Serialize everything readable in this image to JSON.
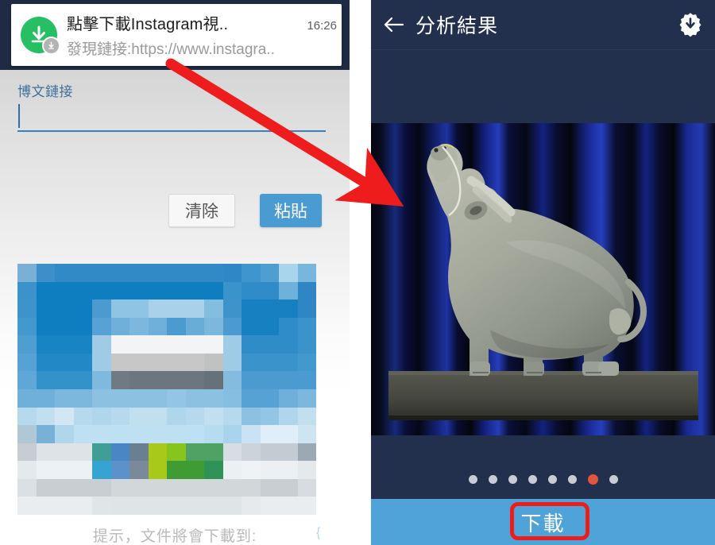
{
  "left_panel": {
    "notification": {
      "icon": "download-circle-icon",
      "badge_icon": "download-badge-icon",
      "title": "點擊下載Instagram視..",
      "time": "16:26",
      "subtitle": "發現鏈接:https://www.instagra.."
    },
    "form": {
      "field_label": "博文鏈接",
      "field_value": "",
      "field_placeholder": "",
      "clear_label": "清除",
      "paste_label": "粘貼"
    },
    "preview": {
      "alt": "pixelated-thumbnail"
    },
    "hint": "提示，文件將會下載到:",
    "hint_trailing": "{"
  },
  "right_panel": {
    "header": {
      "back_icon": "back-arrow-icon",
      "title": "分析結果",
      "action_icon": "download-settings-icon"
    },
    "photo": {
      "alt": "water-buffalo-ceramic-sculpture-on-pedestal-blue-curtain"
    },
    "pagination": {
      "total": 8,
      "active_index": 7
    },
    "footer": {
      "download_label": "下載"
    }
  },
  "annotation": {
    "arrow": "red-pointer-arrow",
    "highlight": "red-highlight-box-around-download-button"
  },
  "colors": {
    "dark_navy": "#22304d",
    "accent_blue": "#4fa3d8",
    "paste_blue": "#4a9bd1",
    "notify_green": "#27bf63",
    "active_dot": "#e0563a",
    "annotation_red": "#ef1c1c",
    "label_blue": "#3f6f9c"
  }
}
